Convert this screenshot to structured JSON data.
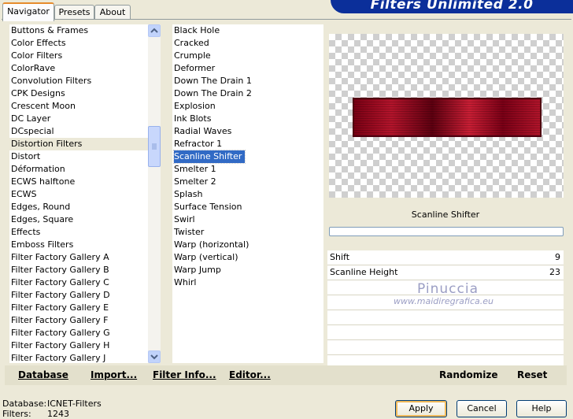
{
  "banner": "Filters Unlimited 2.0",
  "tabs": [
    {
      "label": "Navigator"
    },
    {
      "label": "Presets"
    },
    {
      "label": "About"
    }
  ],
  "categories": [
    "Buttons & Frames",
    "Color Effects",
    "Color Filters",
    "ColorRave",
    "Convolution Filters",
    "CPK Designs",
    "Crescent Moon",
    "DC Layer",
    "DCspecial",
    "Distortion Filters",
    "Distort",
    "Déformation",
    "ECWS halftone",
    "ECWS",
    "Edges, Round",
    "Edges, Square",
    "Effects",
    "Emboss Filters",
    "Filter Factory Gallery A",
    "Filter Factory Gallery B",
    "Filter Factory Gallery C",
    "Filter Factory Gallery D",
    "Filter Factory Gallery E",
    "Filter Factory Gallery F",
    "Filter Factory Gallery G",
    "Filter Factory Gallery H",
    "Filter Factory Gallery J"
  ],
  "selected_category": "Distortion Filters",
  "filters": [
    "Black Hole",
    "Cracked",
    "Crumple",
    "Deformer",
    "Down The Drain 1",
    "Down The Drain 2",
    "Explosion",
    "Ink Blots",
    "Radial Waves",
    "Refractor 1",
    "Scanline Shifter",
    "Smelter 1",
    "Smelter 2",
    "Splash",
    "Surface Tension",
    "Swirl",
    "Twister",
    "Warp (horizontal)",
    "Warp (vertical)",
    "Warp Jump",
    "Whirl"
  ],
  "selected_filter": "Scanline Shifter",
  "filter_title": "Scanline Shifter",
  "params": [
    {
      "label": "Shift",
      "value": "9"
    },
    {
      "label": "Scanline Height",
      "value": "23"
    }
  ],
  "watermark": {
    "name": "Pinuccia",
    "url": "www.maidiregrafica.eu"
  },
  "toolbar": {
    "database": "Database",
    "import": "Import...",
    "filter_info": "Filter Info...",
    "editor": "Editor...",
    "randomize": "Randomize",
    "reset": "Reset"
  },
  "status": {
    "database_label": "Database:",
    "database_value": "ICNET-Filters",
    "filters_label": "Filters:",
    "filters_value": "1243"
  },
  "buttons": {
    "apply": "Apply",
    "cancel": "Cancel",
    "help": "Help"
  },
  "icons": {
    "scroll_up": "chevron-up-icon",
    "scroll_down": "chevron-down-icon"
  },
  "colors": {
    "selection": "#316ac5",
    "banner": "#0b2f9a",
    "window": "#ece9d8"
  }
}
